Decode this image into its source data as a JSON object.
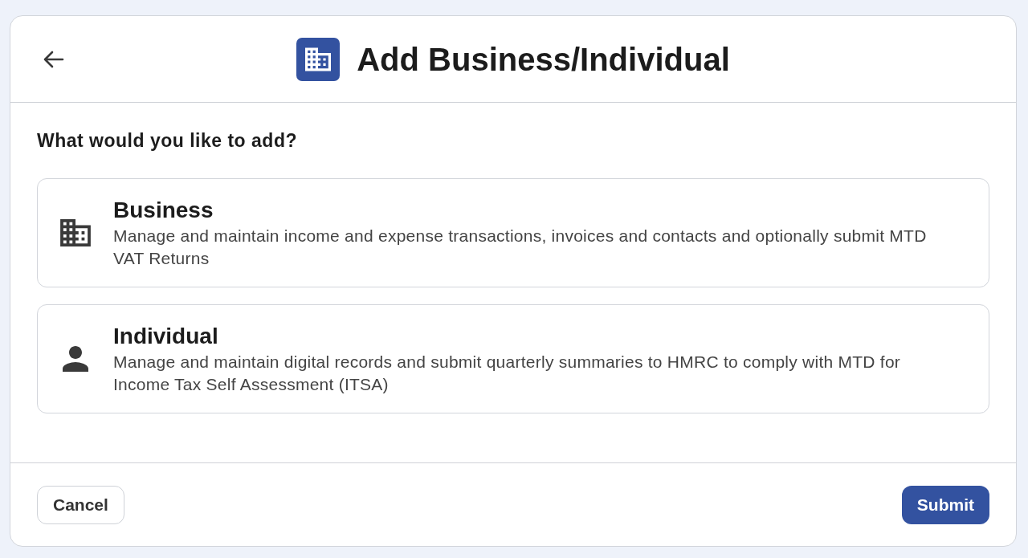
{
  "header": {
    "title": "Add Business/Individual"
  },
  "question": "What would you like to add?",
  "options": [
    {
      "kind": "business",
      "title": "Business",
      "description": "Manage and maintain income and expense transactions, invoices and contacts and optionally submit MTD VAT Returns",
      "selected": false
    },
    {
      "kind": "individual",
      "title": "Individual",
      "description": "Manage and maintain digital records and submit quarterly summaries to HMRC to comply with MTD for Income Tax Self Assessment (ITSA)",
      "selected": false
    }
  ],
  "footer": {
    "buttons": [
      {
        "kind": "secondary",
        "label": "Cancel"
      },
      {
        "kind": "primary",
        "label": "Submit"
      }
    ]
  }
}
